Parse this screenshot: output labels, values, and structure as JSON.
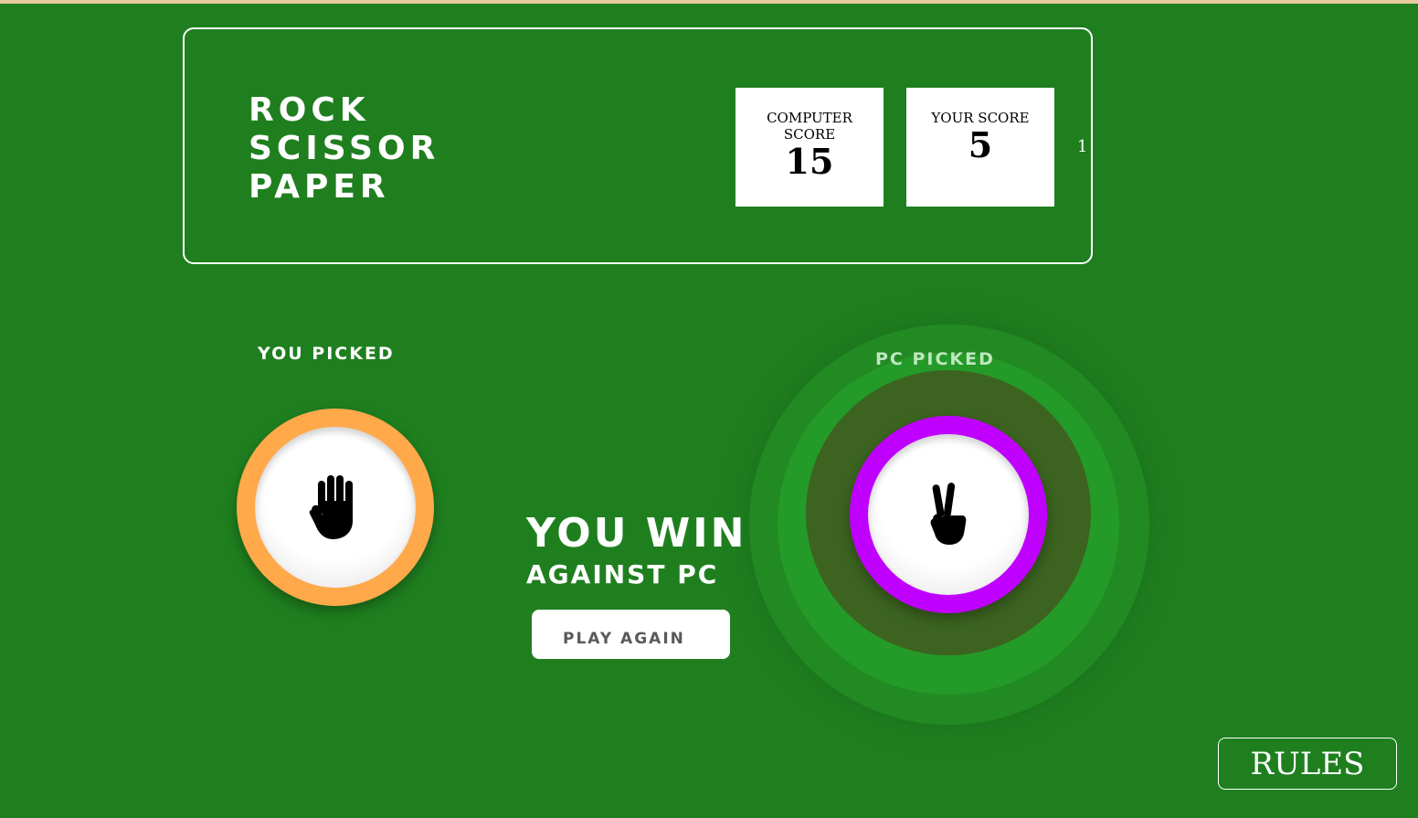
{
  "header": {
    "title_lines": [
      "ROCK",
      "SCISSOR",
      "PAPER"
    ],
    "computer_score": {
      "label": "COMPUTER SCORE",
      "value": "15"
    },
    "player_score": {
      "label": "YOUR SCORE",
      "value": "5"
    },
    "side_counter": "1"
  },
  "game": {
    "you_picked_label": "YOU PICKED",
    "pc_picked_label": "PC PICKED",
    "you_pick_icon": "hand-paper-icon",
    "pc_pick_icon": "scissors-icon",
    "you_chip_color": "#ffa94a",
    "pc_chip_color": "#c000ff",
    "result_main": "YOU WIN",
    "result_sub": "AGAINST PC",
    "play_again_label": "PLAY AGAIN"
  },
  "rules_label": "RULES",
  "colors": {
    "background": "#1f7f1f",
    "accent": "#ffffff"
  }
}
